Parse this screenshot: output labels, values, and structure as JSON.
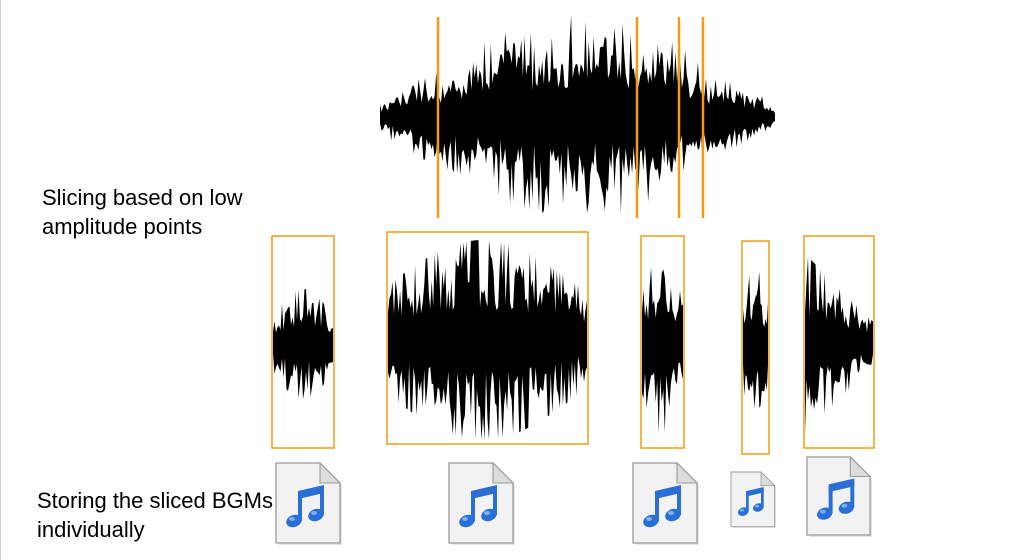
{
  "captions": {
    "slicing": "Slicing based on low amplitude points",
    "storing": "Storing the sliced BGMs individually"
  },
  "colors": {
    "waveform": "#000000",
    "slice_marker": "#f39c12",
    "segment_box": "#f39c12",
    "music_note": "#2a6fd6",
    "file_paper": "#f2f2f2"
  },
  "icons": {
    "audio_file": "audio-file-icon",
    "music_note": "music-note-icon"
  }
}
